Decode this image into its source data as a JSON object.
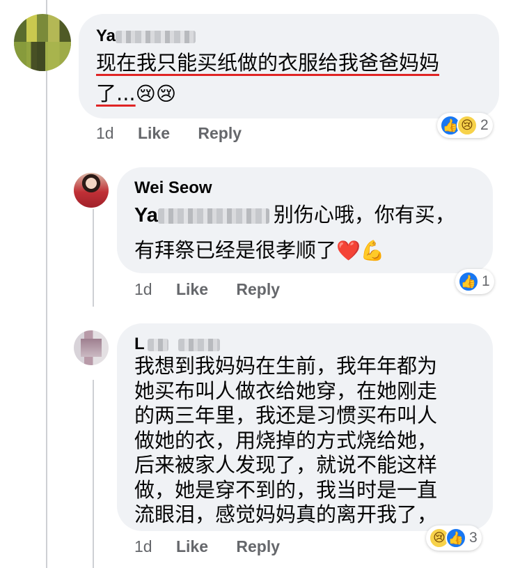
{
  "comments": [
    {
      "author_prefix": "Ya",
      "text_line1": "现在我只能买纸做的衣服给我爸爸妈妈",
      "text_line2": "了...",
      "emojis": "😢😢",
      "time": "1d",
      "like_label": "Like",
      "reply_label": "Reply",
      "reactions": [
        "like-icon",
        "sad-icon"
      ],
      "reaction_count": "2"
    },
    {
      "author": "Wei Seow",
      "mention_prefix": "Ya",
      "text_line1": "别伤心哦，你有买，",
      "text_line2": "有拜祭已经是很孝顺了",
      "emojis": "❤️💪",
      "time": "1d",
      "like_label": "Like",
      "reply_label": "Reply",
      "reactions": [
        "like-icon"
      ],
      "reaction_count": "1"
    },
    {
      "author_prefix": "L",
      "lines": [
        "我想到我妈妈在生前，我年年都为",
        "她买布叫人做衣给她穿，在她刚走",
        "的两三年里，我还是习惯买布叫人",
        "做她的衣，用烧掉的方式烧给她，",
        "后来被家人发现了，就说不能这样",
        "做，她是穿不到的，我当时是一直",
        "流眼泪，感觉妈妈真的离开我了，"
      ],
      "time": "1d",
      "like_label": "Like",
      "reply_label": "Reply",
      "reactions": [
        "sad-icon",
        "like-icon"
      ],
      "reaction_count": "3"
    }
  ],
  "colors": {
    "bubble": "#f0f2f5",
    "like_blue": "#1877f2",
    "meta_gray": "#65676b",
    "underline_red": "#e02424"
  }
}
